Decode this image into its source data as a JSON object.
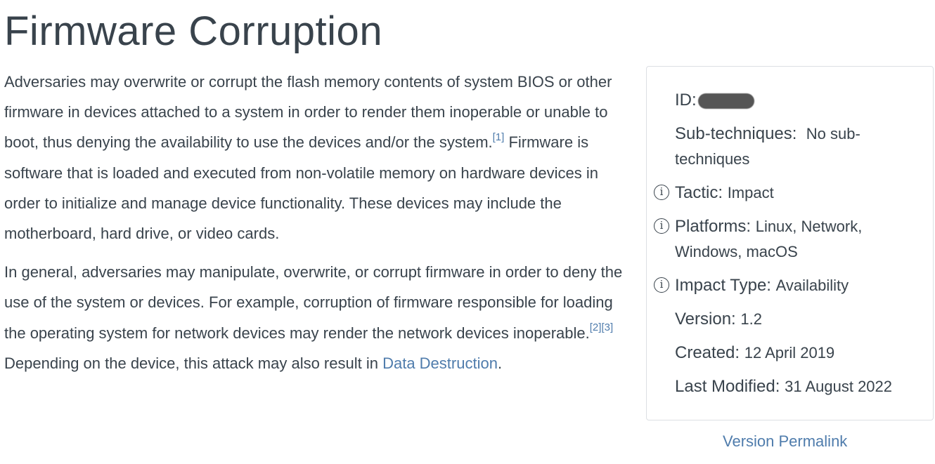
{
  "page": {
    "title": "Firmware Corruption"
  },
  "description": {
    "p1_text_a": "Adversaries may overwrite or corrupt the flash memory contents of system BIOS or other firmware in devices attached to a system in order to render them inoperable or unable to boot, thus denying the availability to use the devices and/or the system.",
    "p1_ref1": "[1]",
    "p1_text_b": " Firmware is software that is loaded and executed from non-volatile memory on hardware devices in order to initialize and manage device functionality. These devices may include the motherboard, hard drive, or video cards.",
    "p2_text_a": "In general, adversaries may manipulate, overwrite, or corrupt firmware in order to deny the use of the system or devices. For example, corruption of firmware responsible for loading the operating system for network devices may render the network devices inoperable.",
    "p2_ref2": "[2]",
    "p2_ref3": "[3]",
    "p2_text_b": " Depending on the device, this attack may also result in ",
    "p2_link": "Data Destruction",
    "p2_text_c": "."
  },
  "card": {
    "id_label": "ID:",
    "subtech_label": "Sub-techniques:",
    "subtech_value": "No sub-techniques",
    "tactic_label": "Tactic:",
    "tactic_value": "Impact",
    "platforms_label": "Platforms:",
    "platforms_value": "Linux, Network, Windows, macOS",
    "impact_label": "Impact Type:",
    "impact_value": "Availability",
    "version_label": "Version:",
    "version_value": "1.2",
    "created_label": "Created:",
    "created_value": "12 April 2019",
    "modified_label": "Last Modified:",
    "modified_value": "31 August 2022"
  },
  "permalink": "Version Permalink",
  "colors": {
    "text": "#39434c",
    "link": "#4f7cac",
    "border": "#dcdfe3"
  }
}
